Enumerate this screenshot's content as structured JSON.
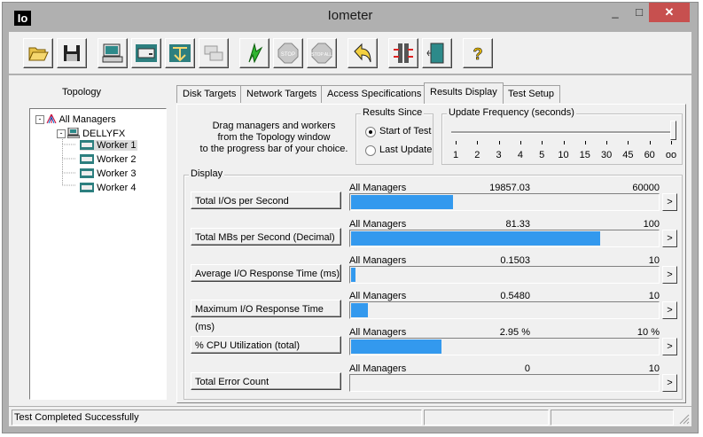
{
  "window": {
    "title": "Iometer",
    "icon_text": "Io",
    "controls": {
      "minimize": "_",
      "maximize": "□",
      "close": "✕"
    }
  },
  "toolbar": {
    "buttons": [
      {
        "name": "open-config",
        "icon": "folder-open-icon"
      },
      {
        "name": "save-config",
        "icon": "floppy-disk-icon"
      },
      {
        "name": "start-manager",
        "icon": "computer-icon"
      },
      {
        "name": "start-disk-worker",
        "icon": "disk-worker-icon"
      },
      {
        "name": "start-network-worker",
        "icon": "network-worker-icon"
      },
      {
        "name": "duplicate-worker",
        "icon": "duplicate-worker-icon"
      },
      {
        "name": "start-tests",
        "icon": "green-flag-icon"
      },
      {
        "name": "stop",
        "icon": "stop-sign-icon",
        "label": "STOP"
      },
      {
        "name": "stop-all",
        "icon": "stop-all-icon",
        "label": "STOP ALL"
      },
      {
        "name": "reset-workers",
        "icon": "reset-arrow-icon"
      },
      {
        "name": "disconnect",
        "icon": "disconnect-icon"
      },
      {
        "name": "exit",
        "icon": "exit-door-icon"
      },
      {
        "name": "about",
        "icon": "question-mark-icon",
        "label": "?"
      }
    ]
  },
  "topology": {
    "title": "Topology",
    "root": "All Managers",
    "manager": "DELLYFX",
    "workers": [
      "Worker 1",
      "Worker 2",
      "Worker 3",
      "Worker 4"
    ]
  },
  "tabs": [
    "Disk Targets",
    "Network Targets",
    "Access Specifications",
    "Results Display",
    "Test Setup"
  ],
  "active_tab": "Results Display",
  "drag_text": {
    "line1": "Drag managers and workers",
    "line2": "from the Topology window",
    "line3": "to the progress bar of your choice."
  },
  "results_since": {
    "title": "Results Since",
    "options": [
      "Start of Test",
      "Last Update"
    ],
    "selected": "Start of Test"
  },
  "update_frequency": {
    "title": "Update Frequency (seconds)",
    "ticks": [
      "1",
      "2",
      "3",
      "4",
      "5",
      "10",
      "15",
      "30",
      "45",
      "60",
      "oo"
    ],
    "selected": "oo"
  },
  "display": {
    "title": "Display",
    "metrics": [
      {
        "label": "Total I/Os per Second",
        "source": "All Managers",
        "value": "19857.03",
        "max": "60000",
        "fill": 0.331
      },
      {
        "label": "Total MBs per Second (Decimal)",
        "source": "All Managers",
        "value": "81.33",
        "max": "100",
        "fill": 0.8133
      },
      {
        "label": "Average I/O Response Time (ms)",
        "source": "All Managers",
        "value": "0.1503",
        "max": "10",
        "fill": 0.015
      },
      {
        "label": "Maximum I/O Response Time (ms)",
        "source": "All Managers",
        "value": "0.5480",
        "max": "10",
        "fill": 0.055
      },
      {
        "label": "% CPU Utilization (total)",
        "source": "All Managers",
        "value": "2.95 %",
        "max": "10 %",
        "fill": 0.295
      },
      {
        "label": "Total Error Count",
        "source": "All Managers",
        "value": "0",
        "max": "10",
        "fill": 0
      }
    ],
    "arrow": ">"
  },
  "status": {
    "text": "Test Completed Successfully"
  },
  "colors": {
    "bar_fill": "#3399ee",
    "close_button": "#c7504f",
    "chrome": "#b0b0b0",
    "face": "#f0f0f0"
  }
}
